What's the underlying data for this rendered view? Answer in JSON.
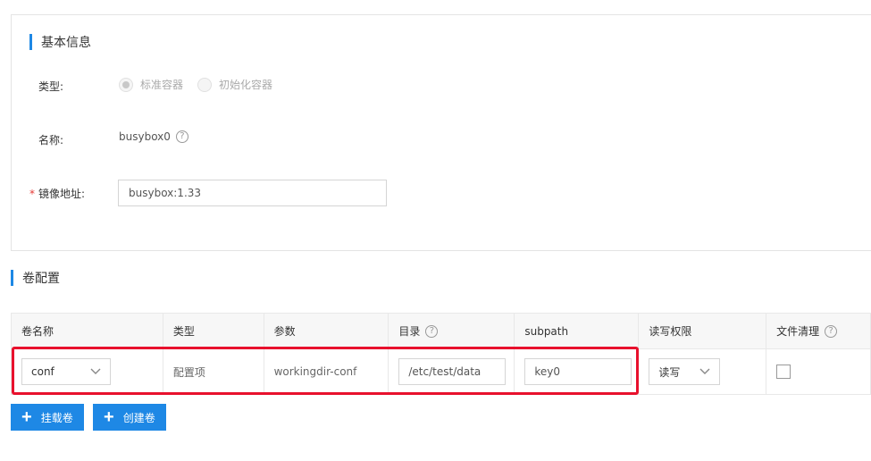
{
  "basic_info": {
    "title": "基本信息",
    "type_label": "类型:",
    "type_options": [
      {
        "label": "标准容器",
        "checked": true
      },
      {
        "label": "初始化容器",
        "checked": false
      }
    ],
    "name_label": "名称:",
    "name_value": "busybox0",
    "image_label": "镜像地址:",
    "image_required_mark": "*",
    "image_value": "busybox:1.33"
  },
  "volume_config": {
    "title": "卷配置",
    "columns": [
      "卷名称",
      "类型",
      "参数",
      "目录",
      "subpath",
      "读写权限",
      "文件清理"
    ],
    "row": {
      "volume_name": "conf",
      "type": "配置项",
      "param": "workingdir-conf",
      "dir": "/etc/test/data",
      "subpath": "key0",
      "permission": "读写",
      "cleanup_checked": false
    },
    "mount_button": "挂载卷",
    "create_button": "创建卷"
  },
  "icons": {
    "help": "?",
    "plus": "+"
  },
  "colors": {
    "accent": "#1e88e5",
    "highlight": "#e8112d",
    "required": "#e53935"
  }
}
